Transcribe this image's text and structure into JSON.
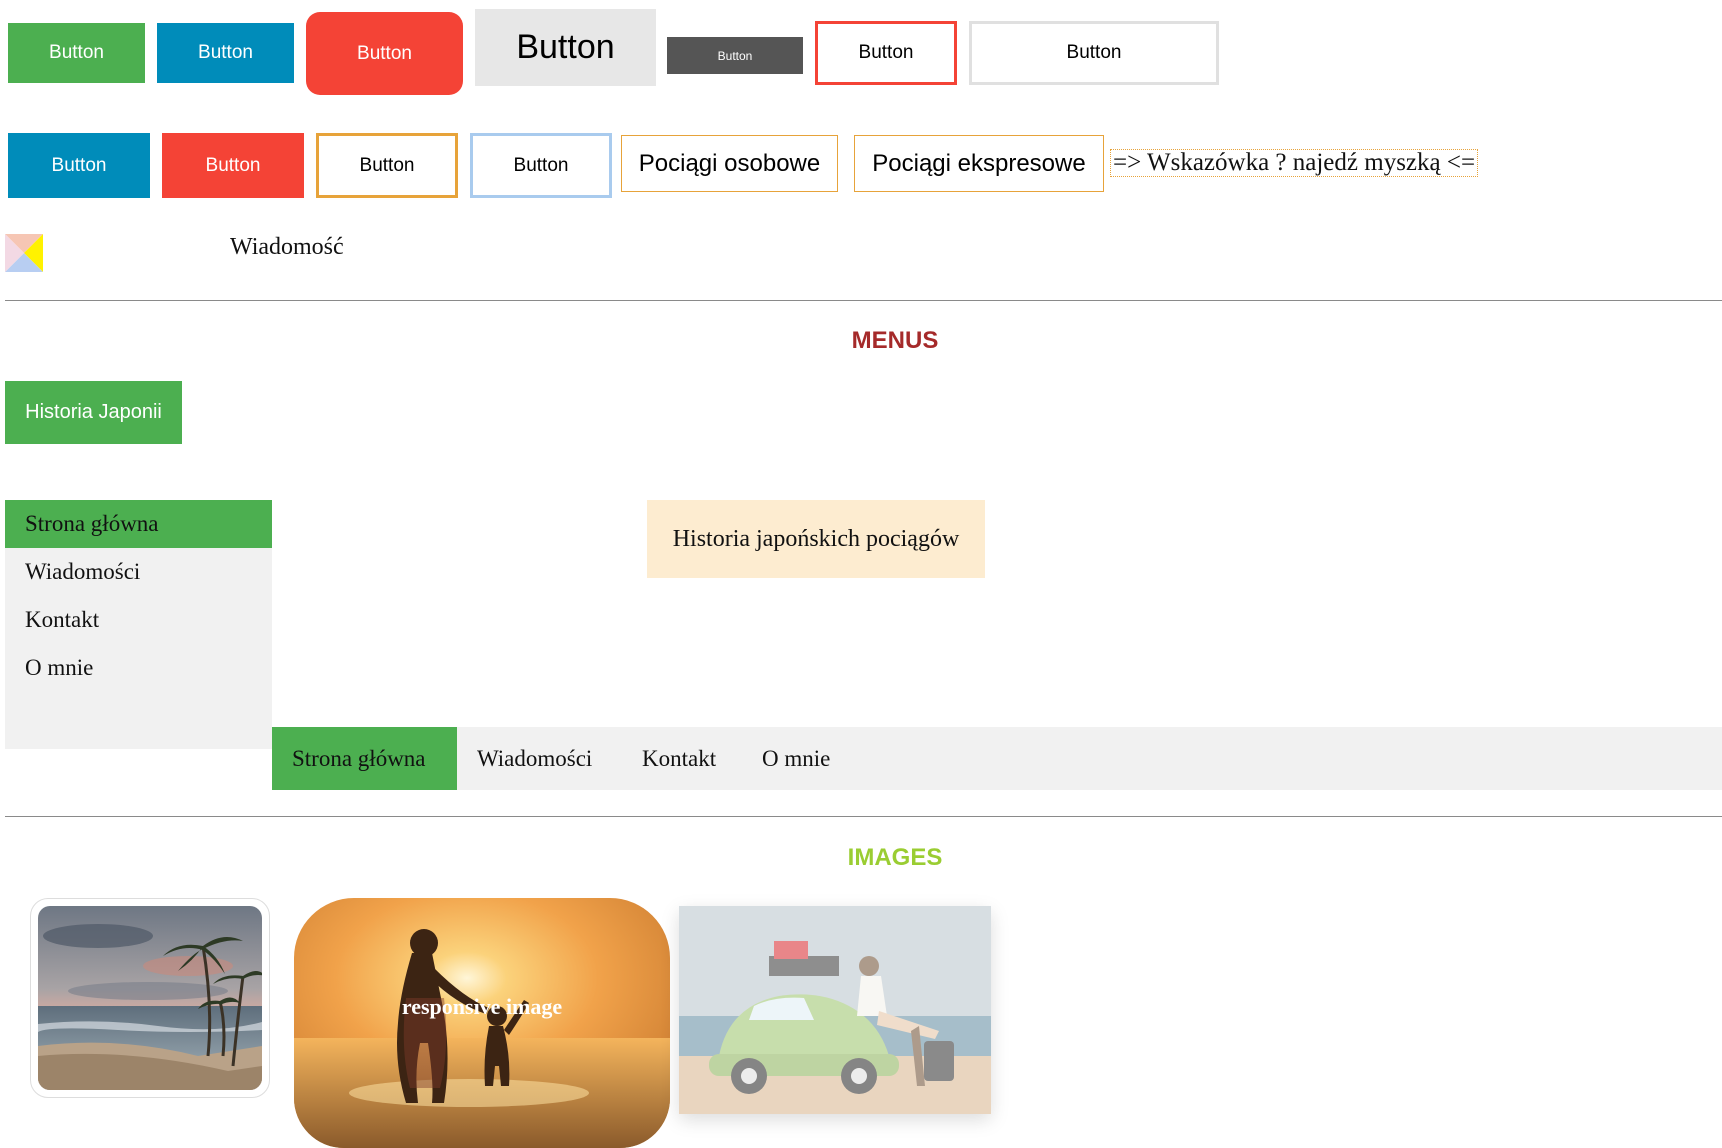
{
  "buttons_row1": [
    {
      "label": "Button"
    },
    {
      "label": "Button"
    },
    {
      "label": "Button"
    },
    {
      "label": "Button"
    },
    {
      "label": "Button"
    },
    {
      "label": "Button"
    },
    {
      "label": "Button"
    }
  ],
  "buttons_row2": [
    {
      "label": "Button"
    },
    {
      "label": "Button"
    },
    {
      "label": "Button"
    },
    {
      "label": "Button"
    },
    {
      "label": "Pociągi osobowe"
    },
    {
      "label": "Pociągi ekspresowe"
    }
  ],
  "tooltip": {
    "label": "=> Wskazówka ? najedź myszką <="
  },
  "message": {
    "label": "Wiadomość"
  },
  "sections": {
    "menus": "MENUS",
    "images": "IMAGES"
  },
  "dropdown": {
    "label": "Historia Japonii"
  },
  "vertical_menu": {
    "items": [
      {
        "label": "Strona główna"
      },
      {
        "label": "Wiadomości"
      },
      {
        "label": "Kontakt"
      },
      {
        "label": "O mnie"
      }
    ]
  },
  "history_box": {
    "label": "Historia japońskich pociągów"
  },
  "horizontal_menu": {
    "items": [
      {
        "label": "Strona główna"
      },
      {
        "label": "Wiadomości"
      },
      {
        "label": "Kontakt"
      },
      {
        "label": "O mnie"
      }
    ]
  },
  "images": {
    "caption": "responsive image"
  },
  "colors": {
    "green": "#4caf50",
    "blue": "#008cba",
    "red": "#f44336",
    "orange": "#e7a33a",
    "light_blue": "#a9cbee",
    "menus_title": "#a52a2a",
    "images_title": "#9acd32"
  }
}
